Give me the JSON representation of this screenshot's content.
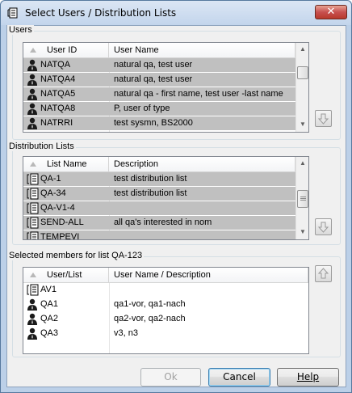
{
  "window": {
    "title": "Select Users / Distribution Lists",
    "close_label": "✕"
  },
  "users": {
    "group_label": "Users",
    "columns": [
      "User ID",
      "User Name"
    ],
    "rows": [
      {
        "id": "NATQA",
        "name": "natural qa, test user"
      },
      {
        "id": "NATQA4",
        "name": "natural qa, test user"
      },
      {
        "id": "NATQA5",
        "name": "natural qa - first name, test user -last name"
      },
      {
        "id": "NATQA8",
        "name": "P, user of type"
      },
      {
        "id": "NATRRI",
        "name": "test sysmn, BS2000"
      }
    ],
    "row_icon": "user-icon",
    "add_button_icon": "arrow-down-icon"
  },
  "distribution_lists": {
    "group_label": "Distribution Lists",
    "columns": [
      "List Name",
      "Description"
    ],
    "rows": [
      {
        "id": "QA-1",
        "name": "test distribution list"
      },
      {
        "id": "QA-34",
        "name": "test distribution list"
      },
      {
        "id": "QA-V1-4",
        "name": ""
      },
      {
        "id": "SEND-ALL",
        "name": "all qa's interested in nom"
      },
      {
        "id": "TEMPEVI",
        "name": ""
      }
    ],
    "row_icon": "distribution-list-icon",
    "add_button_icon": "arrow-down-icon"
  },
  "members": {
    "group_label": "Selected members for list QA-123",
    "columns": [
      "User/List",
      "User Name / Description"
    ],
    "rows": [
      {
        "id": "AV1",
        "name": "",
        "icon": "distribution-list-icon"
      },
      {
        "id": "QA1",
        "name": "qa1-vor, qa1-nach",
        "icon": "user-icon"
      },
      {
        "id": "QA2",
        "name": "qa2-vor, qa2-nach",
        "icon": "user-icon"
      },
      {
        "id": "QA3",
        "name": "v3, n3",
        "icon": "user-icon"
      }
    ],
    "remove_button_icon": "arrow-up-icon"
  },
  "buttons": {
    "ok": "Ok",
    "cancel": "Cancel",
    "help": "Help"
  }
}
